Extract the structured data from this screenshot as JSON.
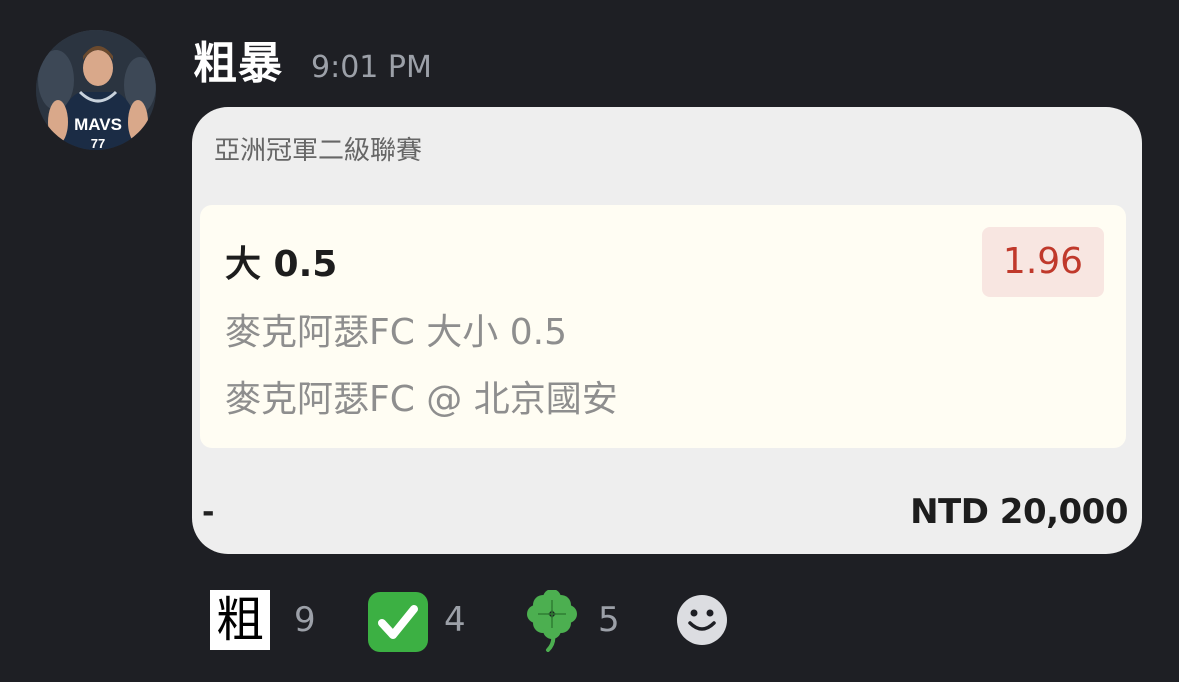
{
  "message": {
    "username": "粗暴",
    "timestamp": "9:01 PM",
    "avatar": {
      "jersey_text": "MAVS",
      "jersey_number": "77"
    }
  },
  "bet_card": {
    "league": "亞洲冠軍二級聯賽",
    "selection": "大 0.5",
    "odds": "1.96",
    "market": "麥克阿瑟FC 大小 0.5",
    "match": "麥克阿瑟FC @ 北京國安",
    "footer_left": "-",
    "stake": "NTD 20,000"
  },
  "reactions": [
    {
      "emoji": "粗",
      "count": "9",
      "icon": "custom-cu-emoji"
    },
    {
      "emoji": "check-mark-icon",
      "count": "4",
      "icon": "check-mark-icon"
    },
    {
      "emoji": "four-leaf-clover-icon",
      "count": "5",
      "icon": "four-leaf-clover-icon"
    }
  ],
  "add_reaction_icon": "smiley-add-reaction-icon",
  "colors": {
    "background": "#1e1f24",
    "card": "#eeeeee",
    "selection_bg": "#fffdf3",
    "odds_text": "#c0392b",
    "odds_bg": "#f8e6e1",
    "check_green": "#3cb043",
    "clover_green": "#4caf50"
  }
}
